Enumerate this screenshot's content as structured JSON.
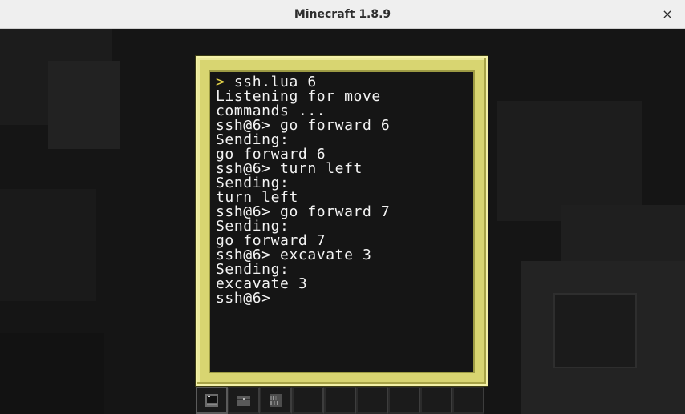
{
  "window": {
    "title": "Minecraft 1.8.9",
    "close_label": "×"
  },
  "terminal": {
    "lines": [
      {
        "prompt": ">",
        "text": " ssh.lua 6"
      },
      {
        "prompt": "",
        "text": "Listening for move"
      },
      {
        "prompt": "",
        "text": "commands ..."
      },
      {
        "prompt": "",
        "text": "ssh@6> go forward 6"
      },
      {
        "prompt": "",
        "text": "Sending:"
      },
      {
        "prompt": "",
        "text": "go forward 6"
      },
      {
        "prompt": "",
        "text": "ssh@6> turn left"
      },
      {
        "prompt": "",
        "text": "Sending:"
      },
      {
        "prompt": "",
        "text": "turn left"
      },
      {
        "prompt": "",
        "text": "ssh@6> go forward 7"
      },
      {
        "prompt": "",
        "text": "Sending:"
      },
      {
        "prompt": "",
        "text": "go forward 7"
      },
      {
        "prompt": "",
        "text": "ssh@6> excavate 3"
      },
      {
        "prompt": "",
        "text": "Sending:"
      },
      {
        "prompt": "",
        "text": "excavate 3"
      },
      {
        "prompt": "",
        "text": "ssh@6>"
      }
    ]
  },
  "hotbar": {
    "slots": [
      {
        "icon": "computer-icon",
        "selected": true
      },
      {
        "icon": "chest-icon",
        "selected": false
      },
      {
        "icon": "bookshelf-icon",
        "selected": false
      },
      {
        "icon": "",
        "selected": false
      },
      {
        "icon": "",
        "selected": false
      },
      {
        "icon": "",
        "selected": false
      },
      {
        "icon": "",
        "selected": false
      },
      {
        "icon": "",
        "selected": false
      },
      {
        "icon": "",
        "selected": false
      }
    ]
  },
  "colors": {
    "frame": "#d8d571",
    "screen_bg": "#151515",
    "text": "#f4f4f4",
    "prompt": "#e5d44a"
  }
}
